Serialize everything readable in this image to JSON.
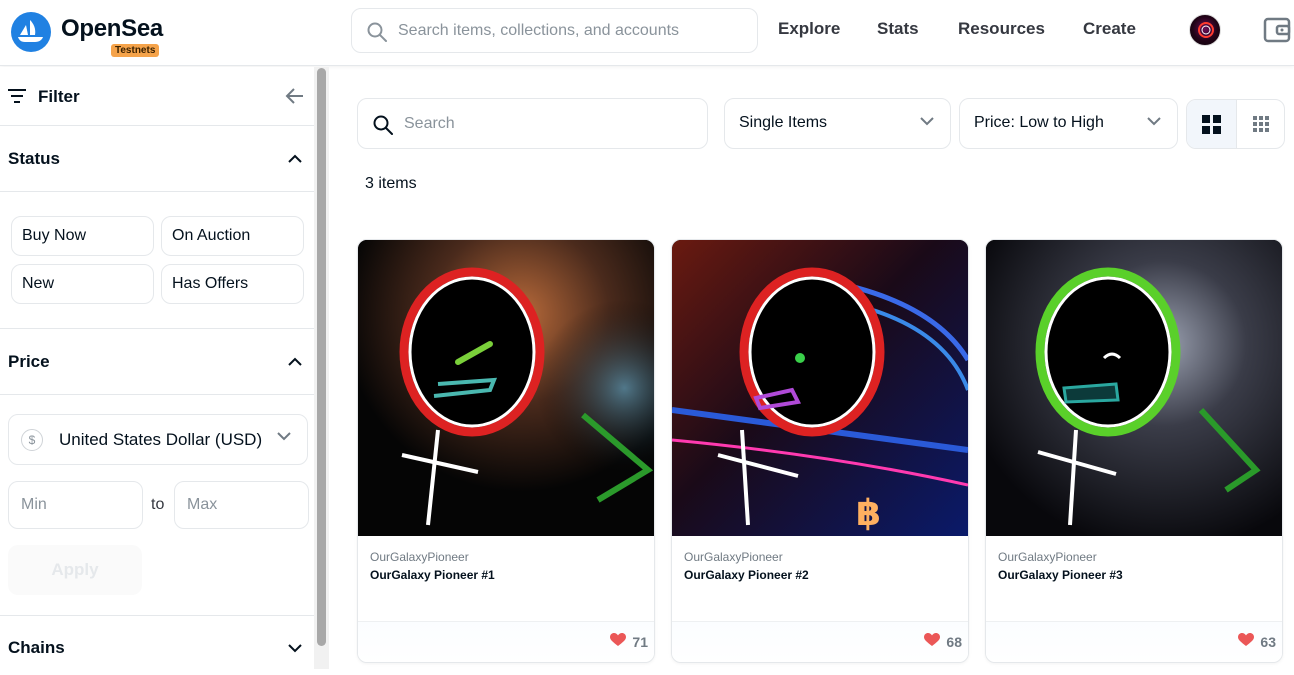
{
  "header": {
    "brand": "OpenSea",
    "badge": "Testnets",
    "search_placeholder": "Search items, collections, and accounts",
    "nav": [
      "Explore",
      "Stats",
      "Resources",
      "Create"
    ]
  },
  "sidebar": {
    "filter_label": "Filter",
    "status": {
      "title": "Status",
      "options": [
        "Buy Now",
        "On Auction",
        "New",
        "Has Offers"
      ]
    },
    "price": {
      "title": "Price",
      "currency": "United States Dollar (USD)",
      "min_placeholder": "Min",
      "to_label": "to",
      "max_placeholder": "Max",
      "apply_label": "Apply"
    },
    "chains": {
      "title": "Chains"
    }
  },
  "main": {
    "search_placeholder": "Search",
    "item_type": "Single Items",
    "sort": "Price: Low to High",
    "count": "3 items",
    "items": [
      {
        "collection": "OurGalaxyPioneer",
        "name": "OurGalaxy Pioneer #1",
        "likes": "71"
      },
      {
        "collection": "OurGalaxyPioneer",
        "name": "OurGalaxy Pioneer #2",
        "likes": "68"
      },
      {
        "collection": "OurGalaxyPioneer",
        "name": "OurGalaxy Pioneer #3",
        "likes": "63"
      }
    ]
  },
  "colors": {
    "brand_blue": "#2081e2",
    "testnet_badge": "#f5a34a",
    "heart": "#eb5757"
  },
  "icons": [
    "opensea-logo-icon",
    "search-icon",
    "avatar",
    "wallet-icon",
    "filter-icon",
    "arrow-left-icon",
    "chevron-up-icon",
    "chevron-down-icon",
    "dollar-icon",
    "grid-large-icon",
    "grid-small-icon",
    "heart-icon"
  ]
}
